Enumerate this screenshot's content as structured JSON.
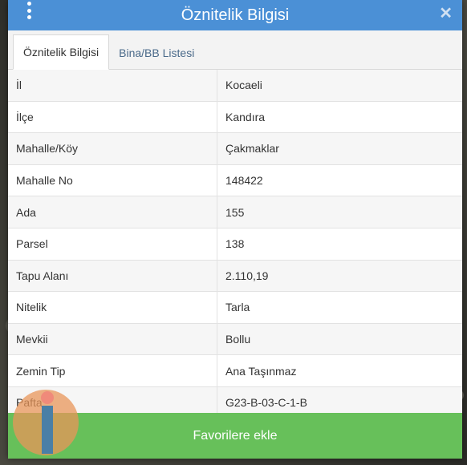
{
  "dialog": {
    "title": "Öznitelik Bilgisi",
    "close_glyph": "✕"
  },
  "tabs": [
    {
      "label": "Öznitelik Bilgisi",
      "active": true
    },
    {
      "label": "Bina/BB Listesi",
      "active": false
    }
  ],
  "attributes": [
    {
      "label": "İl",
      "value": "Kocaeli"
    },
    {
      "label": "İlçe",
      "value": "Kandıra"
    },
    {
      "label": "Mahalle/Köy",
      "value": "Çakmaklar"
    },
    {
      "label": "Mahalle No",
      "value": "148422"
    },
    {
      "label": "Ada",
      "value": "155"
    },
    {
      "label": "Parsel",
      "value": "138"
    },
    {
      "label": "Tapu Alanı",
      "value": "2.110,19"
    },
    {
      "label": "Nitelik",
      "value": "Tarla"
    },
    {
      "label": "Mevkii",
      "value": "Bollu"
    },
    {
      "label": "Zemin Tip",
      "value": "Ana Taşınmaz"
    },
    {
      "label": "Pafta",
      "value": "G23-B-03-C-1-B"
    }
  ],
  "footer": {
    "favorite_label": "Favorilere ekle"
  },
  "colors": {
    "header": "#4b90d6",
    "footer_button": "#67c05a"
  },
  "icons": {
    "menu": "vertical-dots-icon",
    "close": "close-icon",
    "info": "info-icon"
  }
}
